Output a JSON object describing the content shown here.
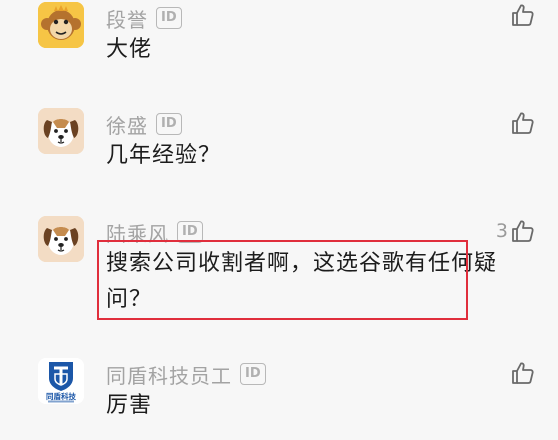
{
  "comments": [
    {
      "username": "段誉",
      "badge": "ID",
      "text": "大佬",
      "avatar": "monkey-avatar",
      "likes": ""
    },
    {
      "username": "徐盛",
      "badge": "ID",
      "text": "几年经验？",
      "avatar": "dog-avatar",
      "likes": ""
    },
    {
      "username": "陆乘风",
      "badge": "ID",
      "text_line1": "搜索公司收割者啊，这选谷歌有任何疑",
      "text_line2": "问？",
      "avatar": "dog-avatar",
      "likes": "3"
    },
    {
      "username": "同盾科技员工",
      "badge": "ID",
      "text": "厉害",
      "avatar": "tongdun-logo",
      "logo_text": "同盾科技",
      "likes": ""
    }
  ],
  "colors": {
    "highlight": "#e02e3c",
    "username": "#a3a3a3",
    "text": "#1c1c1c",
    "background": "#f7f7f7"
  }
}
